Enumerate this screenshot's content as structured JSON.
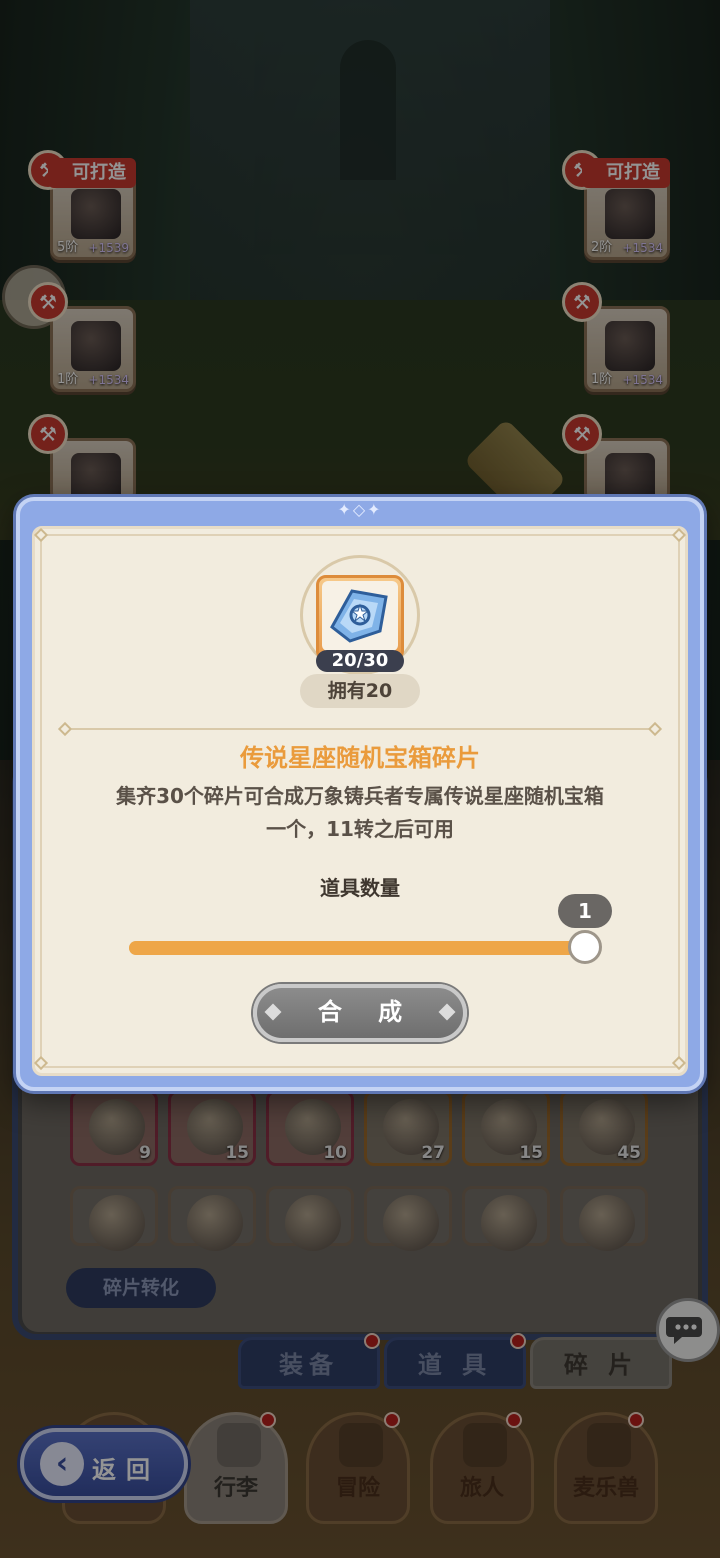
{
  "scene": {
    "forge_tag": "可打造",
    "slots": [
      {
        "tier": "5阶",
        "power": "+1539"
      },
      {
        "tier": "2阶",
        "power": "+1534"
      },
      {
        "tier": "1阶",
        "power": "+1534"
      },
      {
        "tier": "1阶",
        "power": "+1534"
      }
    ]
  },
  "modal": {
    "count": "20/30",
    "owned": "拥有20",
    "title": "传说星座随机宝箱碎片",
    "description_line1": "集齐30个碎片可合成万象铸兵者专属传说星座随机宝箱",
    "description_line2": "一个，11转之后可用",
    "qty_label": "道具数量",
    "qty_value": "1",
    "slider_fraction": 1.0,
    "synth_button": "合 成"
  },
  "bag": {
    "fragments_row1": [
      "9",
      "15",
      "10",
      "27",
      "15",
      "45"
    ],
    "convert_button": "碎片转化",
    "tabs": [
      "装备",
      "道 具",
      "碎 片"
    ],
    "active_tab": "碎 片"
  },
  "nav": {
    "back": "返回",
    "items": [
      "行李",
      "冒险",
      "旅人",
      "麦乐兽"
    ]
  },
  "colors": {
    "accent_orange": "#ea9b3c",
    "modal_blue": "#8ea9e6",
    "badge_red": "#c93a2f"
  }
}
